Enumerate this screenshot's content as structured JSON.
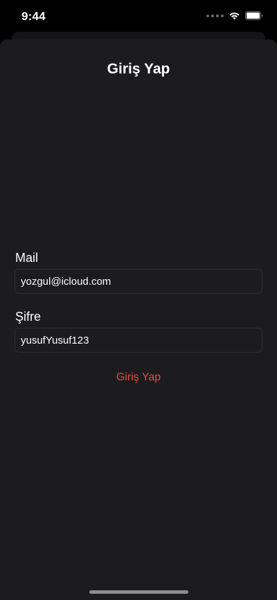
{
  "status_bar": {
    "time": "9:44",
    "signal_icon": "signal-dots-icon",
    "wifi_icon": "wifi-icon",
    "battery_icon": "battery-icon"
  },
  "nav": {
    "title": "Giriş Yap"
  },
  "form": {
    "mail_label": "Mail",
    "mail_value": "yozgul@icloud.com",
    "password_label": "Şifre",
    "password_value": "yusufYusuf123",
    "submit_label": "Giriş Yap"
  },
  "colors": {
    "background": "#000000",
    "sheet": "#1c1c1e",
    "accent": "#eb4a3f"
  }
}
